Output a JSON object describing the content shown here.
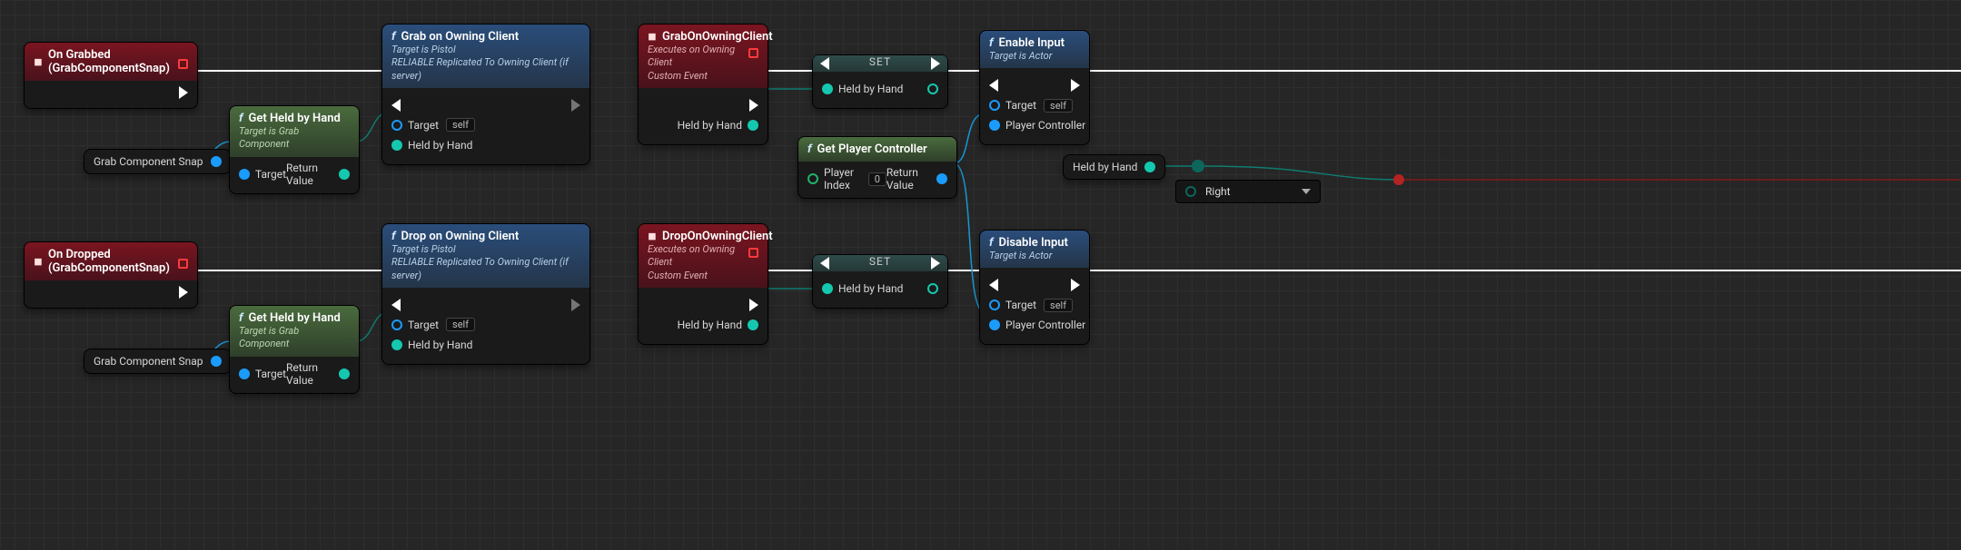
{
  "nodes": {
    "onGrabbed": {
      "title": "On Grabbed (GrabComponentSnap)"
    },
    "onDropped": {
      "title": "On Dropped (GrabComponentSnap)"
    },
    "grabCompSnap1": {
      "label": "Grab Component Snap"
    },
    "grabCompSnap2": {
      "label": "Grab Component Snap"
    },
    "getHeld1": {
      "title": "Get Held by Hand",
      "sub": "Target is Grab Component",
      "target": "Target",
      "return": "Return Value"
    },
    "getHeld2": {
      "title": "Get Held by Hand",
      "sub": "Target is Grab Component",
      "target": "Target",
      "return": "Return Value"
    },
    "grabClient": {
      "title": "Grab on Owning Client",
      "sub1": "Target is Pistol",
      "sub2": "RELIABLE Replicated To Owning Client (if server)",
      "target": "Target",
      "self": "self",
      "held": "Held by Hand"
    },
    "dropClient": {
      "title": "Drop on Owning Client",
      "sub1": "Target is Pistol",
      "sub2": "RELIABLE Replicated To Owning Client (if server)",
      "target": "Target",
      "self": "self",
      "held": "Held by Hand"
    },
    "grabEvent": {
      "title": "GrabOnOwningClient",
      "sub1": "Executes on Owning Client",
      "sub2": "Custom Event",
      "held": "Held by Hand"
    },
    "dropEvent": {
      "title": "DropOnOwningClient",
      "sub1": "Executes on Owning Client",
      "sub2": "Custom Event",
      "held": "Held by Hand"
    },
    "set1": {
      "title": "SET",
      "held": "Held by Hand"
    },
    "set2": {
      "title": "SET",
      "held": "Held by Hand"
    },
    "getPlayer": {
      "title": "Get Player Controller",
      "index": "Player Index",
      "indexVal": "0",
      "return": "Return Value"
    },
    "enable": {
      "title": "Enable Input",
      "sub": "Target is Actor",
      "target": "Target",
      "self": "self",
      "pc": "Player Controller"
    },
    "disable": {
      "title": "Disable Input",
      "sub": "Target is Actor",
      "target": "Target",
      "self": "self",
      "pc": "Player Controller"
    },
    "heldVar": {
      "label": "Held by Hand"
    },
    "dd": {
      "value": "Right"
    }
  }
}
